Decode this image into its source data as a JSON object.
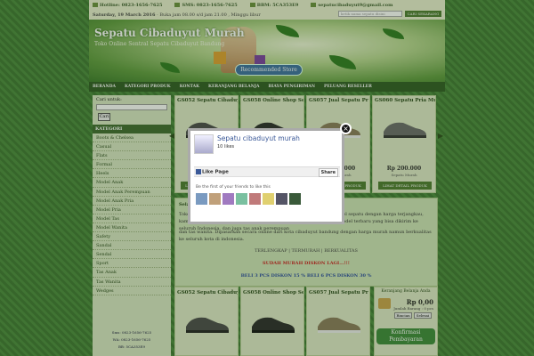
{
  "topbar": {
    "hotline": "Hotline: 0823-1656-7625",
    "sms": "SMS: 0823-1656-7625",
    "bbm": "BBM: 5CA353E9",
    "email": "sepatucibaduyut9@gmail.com",
    "datetime": "Saturday, 19 March 2016",
    "hours": "Buka jam 08.00 s/d jam 21.00 , Minggu libur",
    "search_placeholder": "ketik nama sepatu disini",
    "search_button": "CARI SEKARANG"
  },
  "header": {
    "title": "Sepatu Cibaduyut Murah",
    "tagline": "Toko Online Sentral Sepatu Cibaduyut Bandung",
    "recommended": "Recommended Store"
  },
  "nav": [
    "BERANDA",
    "KATEGORI PRODUK",
    "KONTAK",
    "KERANJANG BELANJA",
    "BIAYA PENGIRIMAN",
    "PELUANG RESELLER"
  ],
  "sidebar": {
    "search_label": "Cari untuk:",
    "search_button": "Cari",
    "category_heading": "KATEGORI",
    "categories": [
      "Boots & Chelsea",
      "Casual",
      "Flats",
      "Formal",
      "Heels",
      "Model Anak",
      "Model Anak Perempuan",
      "Model Anak Pria",
      "Model Pria",
      "Model Tas",
      "Model Wanita",
      "Safety",
      "Sandal",
      "Sendal",
      "Sport",
      "Tas Anak",
      "Tas Wanita",
      "Wedges"
    ],
    "contact": [
      "Sms: 0823-1656-7625",
      "WA: 0823-1656-7625",
      "BB: 5CA353E9"
    ]
  },
  "products": [
    {
      "name": "GS052 Sepatu Cibaduy",
      "price": "",
      "note": ""
    },
    {
      "name": "GS058 Online Shop Se",
      "price": "",
      "note": ""
    },
    {
      "name": "GS057 Jual Sepatu Pr",
      "price": "Rp 200.000",
      "note": "Sepatu Murah"
    },
    {
      "name": "GS060 Sepatu Pria Mu",
      "price": "Rp 200.000",
      "note": "Sepatu Murah"
    }
  ],
  "detail_button": "LIHAT DETAIL PRODUK",
  "description": {
    "title": "Selamat Datang",
    "para1": "Toko online sepatu cibaduyut murah menyediakan berbagai macam model sepatu dengan harga terjangkau, kami menjual sepatu pria dan wanita aneka koleksi sepatu dan sandal model terbaru yang bisa dikirim ke seluruh Indonesia, dan juga tas anak perempuan",
    "para2": "dan tas wanita. Dipasarkan secara online dari kota cibaduyut bandung dengan harga murah namun berkualitas ke seluruh kota di indonesia.",
    "slogan": "TERLENGKAP | TERMURAH | BERKUALITAS",
    "promo1": "SUDAH MURAH DISKON LAGI...!!!",
    "promo2": "BELI 3 PCS DISKON 15 % BELI 6 PCS DISKON 30 %"
  },
  "products2": [
    {
      "name": "GS052 Sepatu Cibaduy"
    },
    {
      "name": "GS058 Online Shop Se"
    },
    {
      "name": "GS057 Jual Sepatu Pr"
    }
  ],
  "cart": {
    "heading": "Keranjang Belanja Anda",
    "amount": "Rp 0,00",
    "count": "Jumlah Barang : 0 pcs",
    "detail_button": "Rincian",
    "checkout_button": "Selesai",
    "confirm_label": "Konfirmasi Pembayaran"
  },
  "popup": {
    "page_name": "Sepatu cibaduyut murah",
    "likes": "10 likes",
    "like_button": "Like Page",
    "share_button": "Share",
    "friends_text": "Be the first of your friends to like this",
    "close_icon": "close-icon"
  },
  "colors": {
    "brand_green": "#3f6a2f",
    "fb_blue": "#3b5998"
  }
}
